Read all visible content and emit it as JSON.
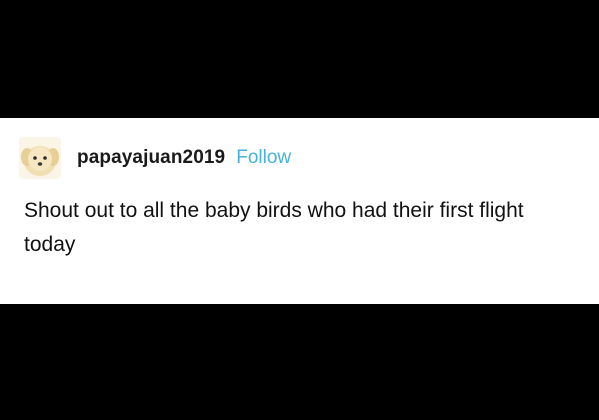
{
  "post": {
    "username": "papayajuan2019",
    "follow_label": "Follow",
    "text": "Shout out to all the baby birds who had their first flight today",
    "avatar_icon": "puppy-avatar-icon"
  },
  "colors": {
    "background_bands": "#000000",
    "post_background": "#ffffff",
    "accent": "#46b3d6",
    "text": "#111111"
  }
}
